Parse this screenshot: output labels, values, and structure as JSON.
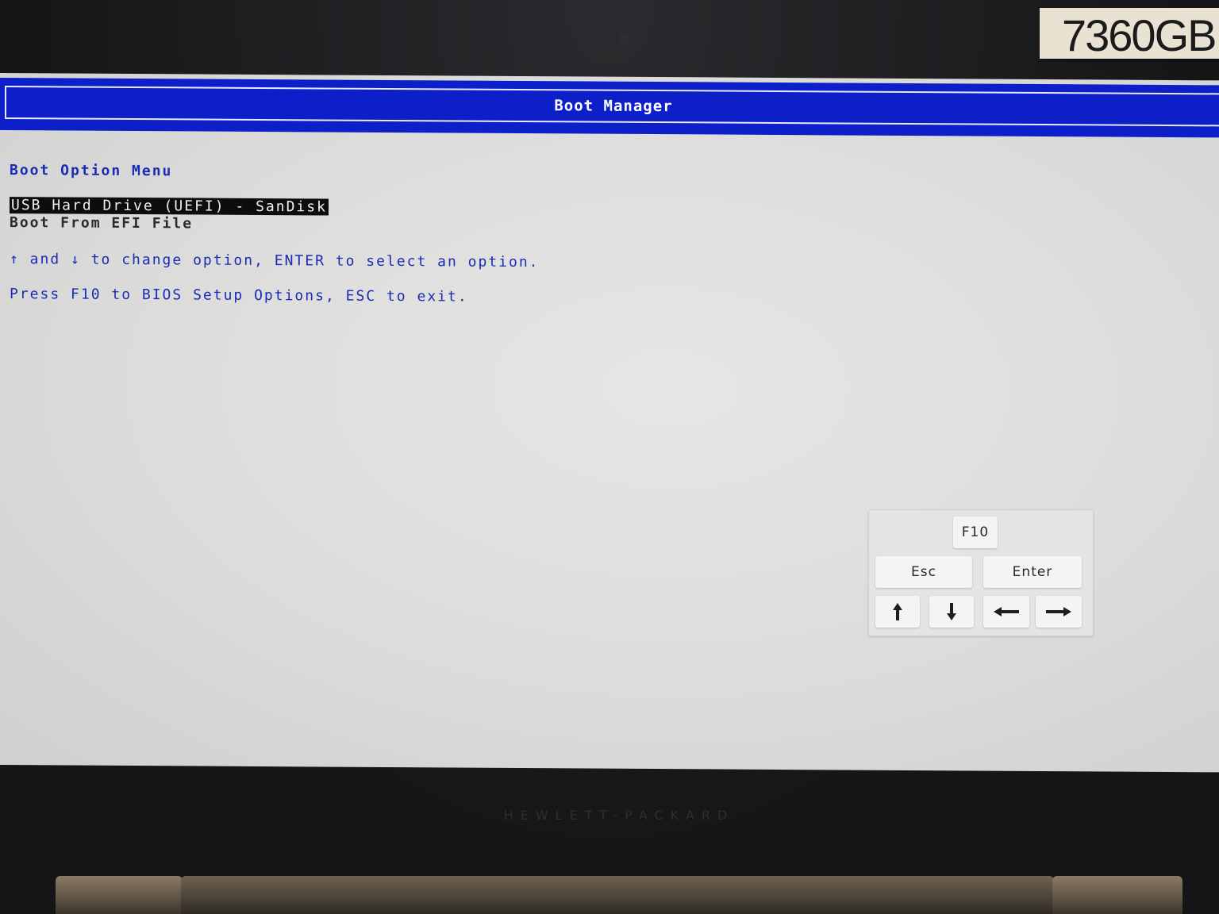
{
  "sticker": {
    "text": "7360GB"
  },
  "header": {
    "title": "Boot Manager"
  },
  "menu": {
    "heading": "Boot Option Menu",
    "options": [
      {
        "label": "USB Hard Drive (UEFI) - SanDisk",
        "selected": true
      },
      {
        "label": "Boot From EFI File",
        "selected": false
      }
    ]
  },
  "help": {
    "line1": "↑ and ↓ to change option, ENTER to select an option.",
    "line2": "Press F10 to BIOS Setup Options, ESC to exit."
  },
  "keypad": {
    "f10": "F10",
    "esc": "Esc",
    "enter": "Enter",
    "arrows": [
      "arrow-up-icon",
      "arrow-down-icon",
      "arrow-left-icon",
      "arrow-right-icon"
    ]
  },
  "bezel": {
    "brand": "HEWLETT-PACKARD"
  },
  "colors": {
    "title_bar": "#0c1fc9",
    "screen_bg": "#dcdcda",
    "text_blue": "#1a2bb8",
    "selection_bg": "#0d0d0d"
  }
}
